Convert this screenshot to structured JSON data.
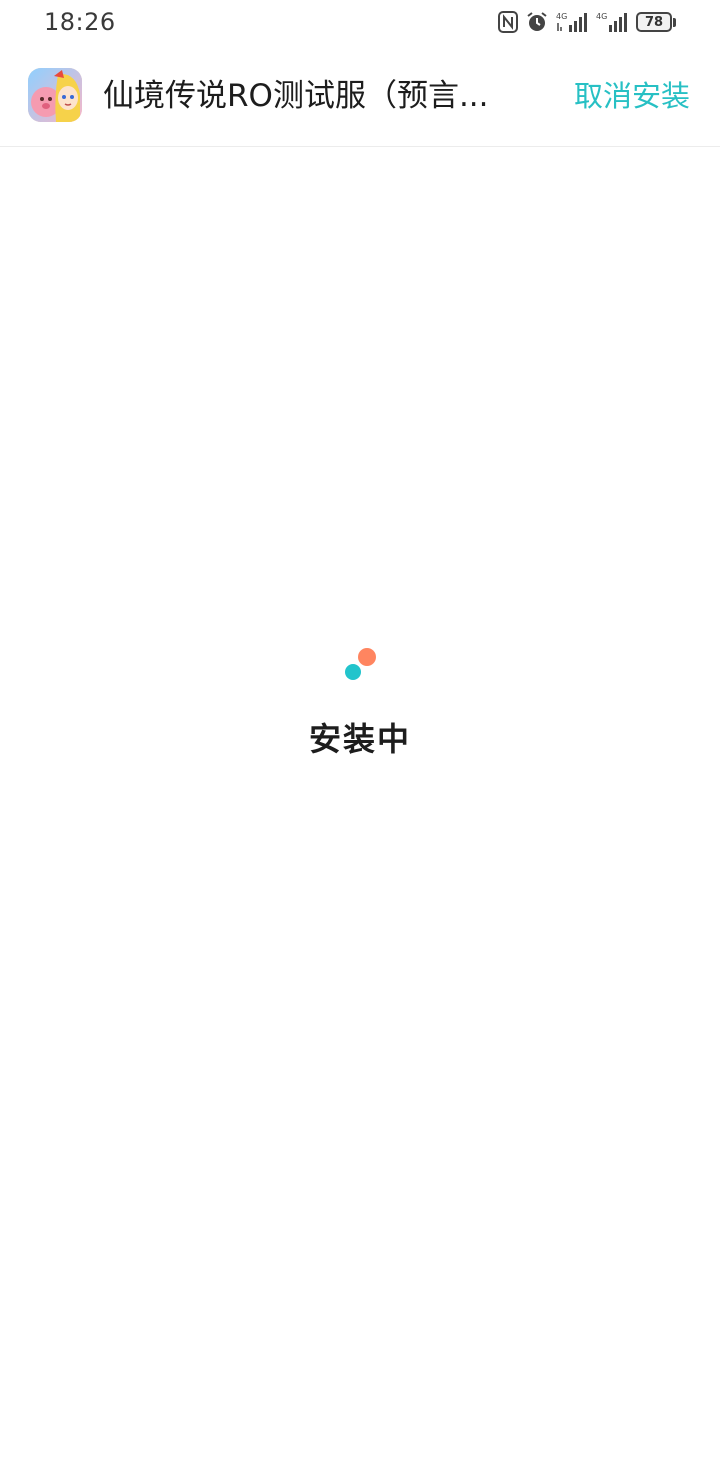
{
  "status_bar": {
    "time": "18:26",
    "icons": [
      "nfc-icon",
      "alarm-icon",
      "signal-4g-icon",
      "signal-4g-icon"
    ],
    "battery": "78"
  },
  "header": {
    "app_icon": "game-character-icon",
    "app_title": "仙境传说RO测试服（预言...",
    "cancel_label": "取消安装"
  },
  "loading": {
    "label": "安装中",
    "dot_colors": [
      "#FF8560",
      "#22C4CC"
    ]
  }
}
